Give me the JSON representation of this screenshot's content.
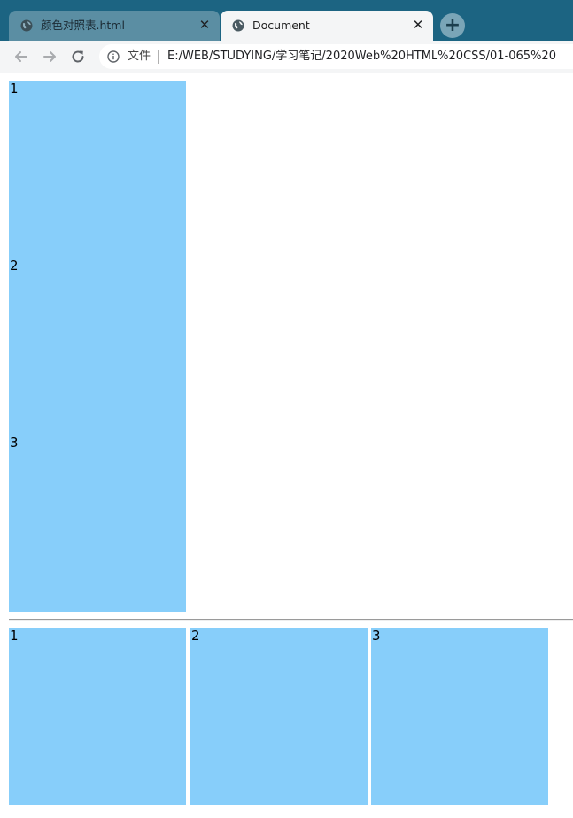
{
  "tabs": [
    {
      "title": "颜色对照表.html",
      "close": "✕",
      "active": false
    },
    {
      "title": "Document",
      "close": "✕",
      "active": true
    }
  ],
  "new_tab_symbol": "+",
  "toolbar": {
    "security_label": "文件",
    "url": "E:/WEB/STUDYING/学习笔记/2020Web%20HTML%20CSS/01-065%20"
  },
  "vertical_boxes": [
    "1",
    "2",
    "3"
  ],
  "horizontal_boxes": [
    "1",
    "2",
    "3"
  ],
  "colors": {
    "tabstrip": "#1c6482",
    "box_fill": "#87cefa"
  }
}
